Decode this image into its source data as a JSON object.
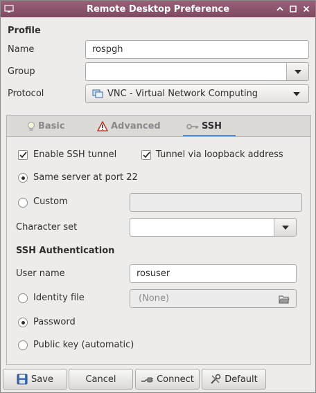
{
  "window": {
    "title": "Remote Desktop Preference"
  },
  "profile": {
    "section_label": "Profile",
    "name_label": "Name",
    "name_value": "rospgh",
    "group_label": "Group",
    "group_value": "",
    "protocol_label": "Protocol",
    "protocol_value": "VNC - Virtual Network Computing"
  },
  "tabs": [
    {
      "label": "Basic",
      "icon": "lightbulb-icon",
      "active": false
    },
    {
      "label": "Advanced",
      "icon": "warning-icon",
      "active": false
    },
    {
      "label": "SSH",
      "icon": "key-icon",
      "active": true
    }
  ],
  "ssh": {
    "enable_tunnel_label": "Enable SSH tunnel",
    "enable_tunnel_checked": true,
    "loopback_label": "Tunnel via loopback address",
    "loopback_checked": true,
    "same_server_label": "Same server at port 22",
    "custom_label": "Custom",
    "server_mode": "same_server",
    "custom_value": "",
    "charset_label": "Character set",
    "charset_value": "",
    "auth_section_label": "SSH Authentication",
    "username_label": "User name",
    "username_value": "rosuser",
    "identity_label": "Identity file",
    "identity_value": "(None)",
    "password_label": "Password",
    "pubkey_label": "Public key (automatic)",
    "auth_mode": "password"
  },
  "buttons": {
    "save": "Save",
    "cancel": "Cancel",
    "connect": "Connect",
    "default": "Default"
  },
  "colors": {
    "titlebar": "#8a536c",
    "tab_active_underline": "#4a90d9"
  }
}
